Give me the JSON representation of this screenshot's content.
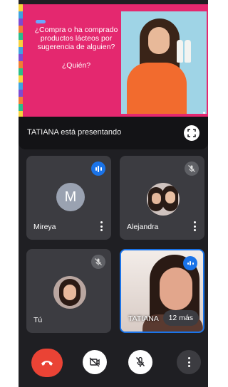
{
  "presentation": {
    "slide_question": "¿Compra o ha comprado productos lácteos por sugerencia de alguien?",
    "slide_sub": "¿Quién?",
    "presenter_label": "TATIANA está presentando"
  },
  "participants": [
    {
      "name": "Mireya",
      "initial": "M",
      "status": "speaking"
    },
    {
      "name": "Alejandra",
      "status": "muted"
    },
    {
      "name": "Tú",
      "status": "muted"
    },
    {
      "name": "TATIANA",
      "status": "speaking",
      "more_badge": "12 más"
    }
  ],
  "colors": {
    "slide_bg": "#e4286f",
    "accent_blue": "#1a73e8",
    "end_call_red": "#ea4335",
    "tile_bg": "#3c3c41",
    "app_bg": "#1f1f23"
  },
  "icons": {
    "fullscreen": "fullscreen-icon",
    "speaking": "audio-level-icon",
    "mic_off": "mic-off-icon",
    "more": "more-vert-icon",
    "end_call": "call-end-icon",
    "camera_off": "videocam-off-icon"
  }
}
